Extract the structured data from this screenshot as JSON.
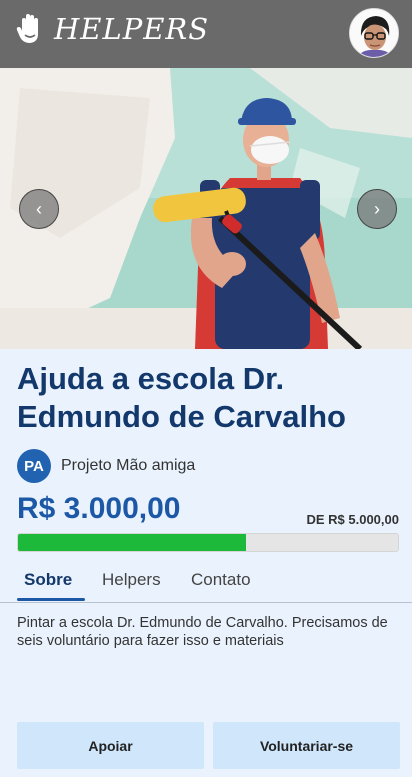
{
  "header": {
    "logo_text": "HELPERS",
    "logo_icon": "hand-icon",
    "avatar": "user-avatar"
  },
  "carousel": {
    "prev_icon": "chevron-left-icon",
    "next_icon": "chevron-right-icon",
    "prev_label": "‹",
    "next_label": "›",
    "image": "worker-with-paint-roller"
  },
  "campaign": {
    "title": "Ajuda a escola Dr. Edmundo de Carvalho",
    "project_initials": "PA",
    "project_name": "Projeto Mão amiga",
    "raised": "R$ 3.000,00",
    "goal": "DE R$ 5.000,00",
    "progress_percent": 60
  },
  "tabs": [
    {
      "label": "Sobre",
      "active": true
    },
    {
      "label": "Helpers",
      "active": false
    },
    {
      "label": "Contato",
      "active": false
    }
  ],
  "description": "Pintar a escola Dr. Edmundo de Carvalho. Precisamos de seis voluntário para fazer isso e materiais",
  "actions": {
    "support_label": "Apoiar",
    "volunteer_label": "Voluntariar-se"
  },
  "colors": {
    "topbar": "#6a6a6a",
    "title": "#13386b",
    "accent": "#1d58a6",
    "progress": "#1db93a",
    "button_bg": "#cfe6fb",
    "page_bg": "#eaf3fd"
  }
}
